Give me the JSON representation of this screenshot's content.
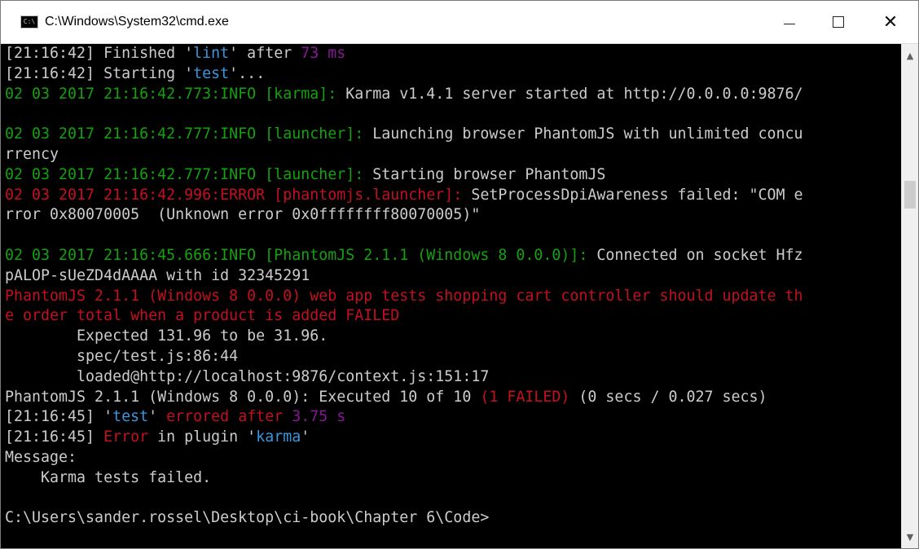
{
  "window": {
    "title": "C:\\Windows\\System32\\cmd.exe",
    "icon_text": "C:\\",
    "controls": {
      "minimize": "minimize-icon",
      "maximize": "maximize-icon",
      "close": "✕"
    }
  },
  "console": {
    "lines": [
      [
        {
          "t": "[21:16:42] Finished ",
          "c": "w"
        },
        {
          "t": "'",
          "c": "w"
        },
        {
          "t": "lint",
          "c": "c"
        },
        {
          "t": "' after ",
          "c": "w"
        },
        {
          "t": "73 ms",
          "c": "m"
        }
      ],
      [
        {
          "t": "[21:16:42] Starting ",
          "c": "w"
        },
        {
          "t": "'",
          "c": "w"
        },
        {
          "t": "test",
          "c": "c"
        },
        {
          "t": "'...",
          "c": "w"
        }
      ],
      [
        {
          "t": "02 03 2017 21:16:42.773:INFO [karma]: ",
          "c": "g"
        },
        {
          "t": "Karma v1.4.1 server started at http://0.0.0.0:9876/",
          "c": "w"
        }
      ],
      [
        {
          "t": "",
          "c": "w"
        }
      ],
      [
        {
          "t": "02 03 2017 21:16:42.777:INFO [launcher]: ",
          "c": "g"
        },
        {
          "t": "Launching browser PhantomJS with unlimited concu",
          "c": "w"
        }
      ],
      [
        {
          "t": "rrency",
          "c": "w"
        }
      ],
      [
        {
          "t": "02 03 2017 21:16:42.777:INFO [launcher]: ",
          "c": "g"
        },
        {
          "t": "Starting browser PhantomJS",
          "c": "w"
        }
      ],
      [
        {
          "t": "02 03 2017 21:16:42.996:ERROR [phantomjs.launcher]: ",
          "c": "r"
        },
        {
          "t": "SetProcessDpiAwareness failed: \"COM e",
          "c": "w"
        }
      ],
      [
        {
          "t": "rror 0x80070005  (Unknown error 0x0ffffffff80070005)\"",
          "c": "w"
        }
      ],
      [
        {
          "t": "",
          "c": "w"
        }
      ],
      [
        {
          "t": "02 03 2017 21:16:45.666:INFO [PhantomJS 2.1.1 (Windows 8 0.0.0)]: ",
          "c": "g"
        },
        {
          "t": "Connected on socket Hfz",
          "c": "w"
        }
      ],
      [
        {
          "t": "pALOP-sUeZD4dAAAA with id 32345291",
          "c": "w"
        }
      ],
      [
        {
          "t": "PhantomJS 2.1.1 (Windows 8 0.0.0) web app tests shopping cart controller should update th",
          "c": "r"
        }
      ],
      [
        {
          "t": "e order total when a product is added FAILED",
          "c": "r"
        }
      ],
      [
        {
          "t": "        Expected 131.96 to be 31.96.",
          "c": "w"
        }
      ],
      [
        {
          "t": "        spec/test.js:86:44",
          "c": "w"
        }
      ],
      [
        {
          "t": "        loaded@http://localhost:9876/context.js:151:17",
          "c": "w"
        }
      ],
      [
        {
          "t": "PhantomJS 2.1.1 (Windows 8 0.0.0): Executed 10 of 10 ",
          "c": "w"
        },
        {
          "t": "(1 FAILED)",
          "c": "r"
        },
        {
          "t": " (0 secs / 0.027 secs)",
          "c": "w"
        }
      ],
      [
        {
          "t": "[21:16:45] ",
          "c": "w"
        },
        {
          "t": "'",
          "c": "w"
        },
        {
          "t": "test",
          "c": "c"
        },
        {
          "t": "' ",
          "c": "w"
        },
        {
          "t": "errored after ",
          "c": "r"
        },
        {
          "t": "3.75 s",
          "c": "m"
        }
      ],
      [
        {
          "t": "[21:16:45] ",
          "c": "w"
        },
        {
          "t": "Error",
          "c": "r"
        },
        {
          "t": " in plugin '",
          "c": "w"
        },
        {
          "t": "karma",
          "c": "c"
        },
        {
          "t": "'",
          "c": "w"
        }
      ],
      [
        {
          "t": "Message:",
          "c": "w"
        }
      ],
      [
        {
          "t": "    Karma tests failed.",
          "c": "w"
        }
      ],
      [
        {
          "t": "",
          "c": "w"
        }
      ],
      [
        {
          "t": "C:\\Users\\sander.rossel\\Desktop\\ci-book\\Chapter 6\\Code>",
          "c": "w"
        }
      ]
    ]
  },
  "scrollbar": {
    "up": "▲",
    "down": "▼"
  },
  "colors": {
    "green": "#13a10e",
    "red": "#c50f1f",
    "cyan": "#3a96dd",
    "magenta": "#881798",
    "default": "#cccccc"
  }
}
